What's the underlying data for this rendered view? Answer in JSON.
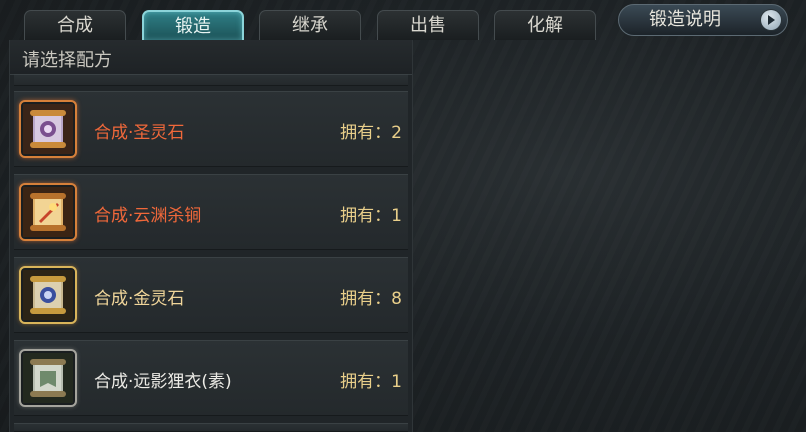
{
  "tabs": [
    {
      "label": "合成",
      "active": false
    },
    {
      "label": "锻造",
      "active": true
    },
    {
      "label": "继承",
      "active": false
    },
    {
      "label": "出售",
      "active": false
    },
    {
      "label": "化解",
      "active": false
    }
  ],
  "help_button": {
    "label": "锻造说明",
    "icon": "play-arrow-icon"
  },
  "panel": {
    "title": "请选择配方"
  },
  "recipes": [
    {
      "name": "合成·圣灵石",
      "count": "拥有：2",
      "name_color": "#f0683a",
      "icon": "scroll-icon"
    },
    {
      "name": "合成·云渊杀锏",
      "count": "拥有：1",
      "name_color": "#f0683a",
      "icon": "scroll-icon"
    },
    {
      "name": "合成·金灵石",
      "count": "拥有：8",
      "name_color": "#f1d69a",
      "icon": "scroll-icon"
    },
    {
      "name": "合成·远影狸衣(素)",
      "count": "拥有：1",
      "name_color": "#ecebe6",
      "icon": "scroll-icon"
    }
  ],
  "colors": {
    "accent_tab": "#2f7f86",
    "owned_text": "#e9cf8a"
  }
}
